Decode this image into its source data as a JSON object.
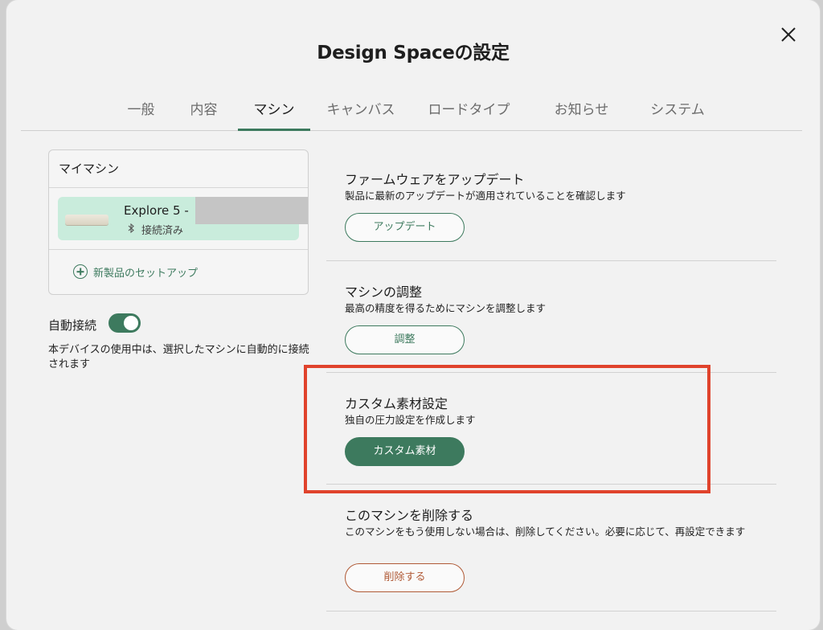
{
  "dialog": {
    "title": "Design Spaceの設定",
    "close_icon": "close-icon"
  },
  "tabs": [
    {
      "label": "一般",
      "active": false
    },
    {
      "label": "内容",
      "active": false
    },
    {
      "label": "マシン",
      "active": true
    },
    {
      "label": "キャンバス",
      "active": false
    },
    {
      "label": "ロードタイプ",
      "active": false
    },
    {
      "label": "お知らせ",
      "active": false
    },
    {
      "label": "システム",
      "active": false
    }
  ],
  "my_machines": {
    "header": "マイマシン",
    "machine": {
      "name": "Explore 5 -",
      "status": "接続済み",
      "status_icon": "bluetooth-icon"
    },
    "setup_link": "新製品のセットアップ"
  },
  "auto_connect": {
    "label": "自動接続",
    "enabled": true,
    "description": "本デバイスの使用中は、選択したマシンに自動的に接続されます"
  },
  "sections": {
    "firmware": {
      "title": "ファームウェアをアップデート",
      "description": "製品に最新のアップデートが適用されていることを確認します",
      "button": "アップデート"
    },
    "calibration": {
      "title": "マシンの調整",
      "description": "最高の精度を得るためにマシンを調整します",
      "button": "調整"
    },
    "custom_material": {
      "title": "カスタム素材設定",
      "description": "独自の圧力設定を作成します",
      "button": "カスタム素材"
    },
    "delete_machine": {
      "title": "このマシンを削除する",
      "description": "このマシンをもう使用しない場合は、削除してください。必要に応じて、再設定できます",
      "button": "削除する"
    }
  },
  "colors": {
    "accent": "#3d7a5e",
    "highlight_box": "#e0432c",
    "danger": "#b05a36",
    "machine_card_bg": "#c9ecdc"
  }
}
